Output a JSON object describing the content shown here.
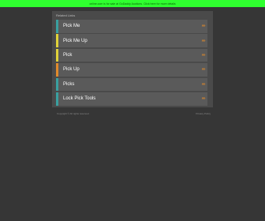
{
  "banner": {
    "text": "online.com is for sale at GoDaddy Auctions. Click here for more details"
  },
  "panel": {
    "header": "Related Links",
    "items": [
      {
        "label": "Pick Me",
        "color": "#3aa0a0",
        "arrow": "»»"
      },
      {
        "label": "Pick Me Up",
        "color": "#e0d23a",
        "arrow": "»»"
      },
      {
        "label": "Pick",
        "color": "#e0d23a",
        "arrow": "»»"
      },
      {
        "label": "Pick Up",
        "color": "#e08a2c",
        "arrow": "»»"
      },
      {
        "label": "Picks",
        "color": "#3aa0a0",
        "arrow": "»»"
      },
      {
        "label": "Lock Pick Tools",
        "color": "#3aa0a0",
        "arrow": "»»"
      }
    ]
  },
  "footer": {
    "left": "Copyright © All rights reserved",
    "right": "Privacy Policy"
  }
}
